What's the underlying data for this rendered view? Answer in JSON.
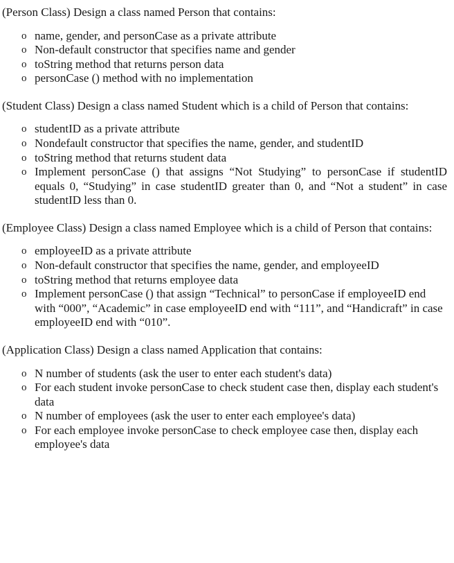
{
  "document": {
    "marker_glyph": "o",
    "sections": [
      {
        "id": "person-class",
        "heading": "(Person Class) Design a class named Person that contains:",
        "items": [
          "name, gender, and personCase as a private attribute",
          "Non-default constructor that specifies name and gender",
          "toString method that returns person data",
          "personCase () method with no implementation"
        ]
      },
      {
        "id": "student-class",
        "heading": "(Student Class) Design a class named Student which is a child of Person that contains:",
        "items": [
          "studentID as a private attribute",
          "Nondefault constructor that specifies the name, gender, and studentID",
          "toString method that returns student data",
          "Implement personCase () that assigns “Not Studying” to personCase if studentID equals 0, “Studying” in case studentID greater than 0, and “Not a student” in case studentID less than 0."
        ]
      },
      {
        "id": "employee-class",
        "heading": "(Employee Class) Design a class named Employee which is a child of Person that contains:",
        "items": [
          "employeeID as a private attribute",
          "Non-default constructor that specifies the name, gender, and employeeID",
          "toString method that returns employee data",
          "Implement personCase () that assign “Technical” to personCase if employeeID end with “000”, “Academic” in case employeeID end with “111”, and “Handicraft” in case employeeID end with “010”."
        ]
      },
      {
        "id": "application-class",
        "heading": "(Application Class) Design a class named Application that contains:",
        "items": [
          "N number of students (ask the user to enter each student's data)",
          "For each student invoke personCase to check student case then, display each student's data",
          "N number of employees (ask the user to enter each employee's data)",
          "For each employee invoke personCase to check employee case then, display each employee's data"
        ]
      }
    ]
  }
}
